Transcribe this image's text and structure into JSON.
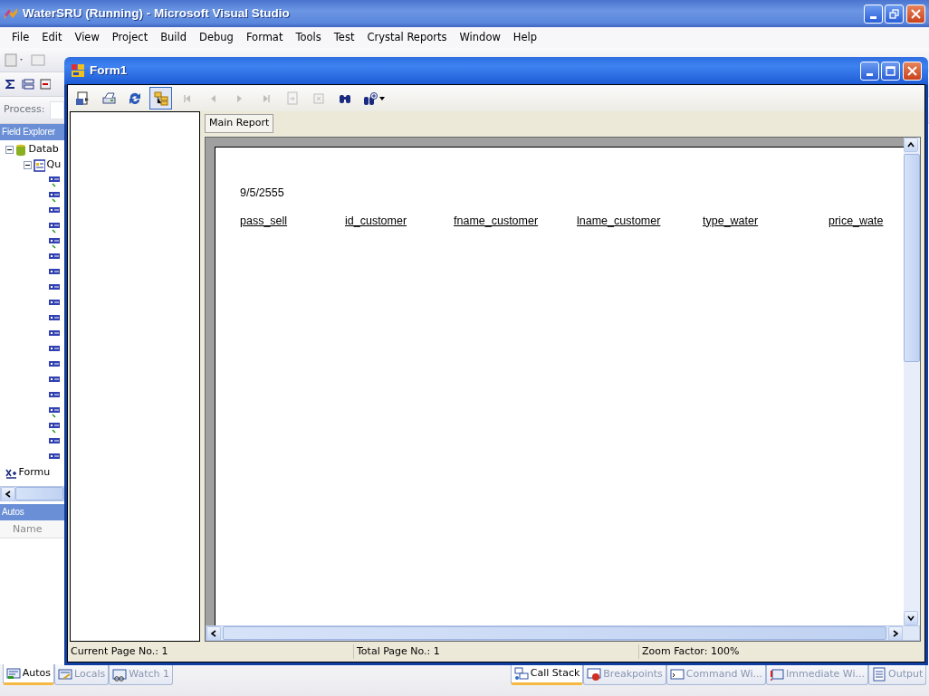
{
  "window": {
    "title": "WaterSRU (Running) - Microsoft Visual Studio"
  },
  "menu": [
    "File",
    "Edit",
    "View",
    "Project",
    "Build",
    "Debug",
    "Format",
    "Tools",
    "Test",
    "Crystal Reports",
    "Window",
    "Help"
  ],
  "toolbar": {
    "process_label": "Process:"
  },
  "field_explorer": {
    "title": "Field Explorer",
    "tree": [
      {
        "kind": "database",
        "label": "Datab",
        "expanded": true,
        "children": [
          {
            "kind": "table",
            "label": "Qu",
            "expanded": true,
            "children": [
              {
                "kind": "field",
                "used": true
              },
              {
                "kind": "field",
                "used": true
              },
              {
                "kind": "field",
                "used": false
              },
              {
                "kind": "field",
                "used": true
              },
              {
                "kind": "field",
                "used": true
              },
              {
                "kind": "field",
                "used": false
              },
              {
                "kind": "field",
                "used": false
              },
              {
                "kind": "field",
                "used": false
              },
              {
                "kind": "field",
                "used": false
              },
              {
                "kind": "field",
                "used": false
              },
              {
                "kind": "field",
                "used": false
              },
              {
                "kind": "field",
                "used": false
              },
              {
                "kind": "field",
                "used": false
              },
              {
                "kind": "field",
                "used": false
              },
              {
                "kind": "field",
                "used": false
              },
              {
                "kind": "field",
                "used": true
              },
              {
                "kind": "field",
                "used": true
              },
              {
                "kind": "field",
                "used": false
              },
              {
                "kind": "field",
                "used": false
              }
            ]
          }
        ]
      },
      {
        "kind": "formula",
        "label": "Formu"
      }
    ]
  },
  "autos": {
    "title": "Autos",
    "columns": [
      "Name"
    ]
  },
  "bottom_tabs_left": [
    {
      "label": "Autos",
      "kind": "autos",
      "selected": true
    },
    {
      "label": "Locals",
      "kind": "locals",
      "selected": false
    },
    {
      "label": "Watch 1",
      "kind": "watch",
      "selected": false
    }
  ],
  "bottom_tabs_right": [
    {
      "label": "Call Stack",
      "kind": "callstack",
      "selected": true
    },
    {
      "label": "Breakpoints",
      "kind": "breakpoints",
      "selected": false
    },
    {
      "label": "Command Wi...",
      "kind": "command",
      "selected": false
    },
    {
      "label": "Immediate Wi...",
      "kind": "immediate",
      "selected": false
    },
    {
      "label": "Output",
      "kind": "output",
      "selected": false
    }
  ],
  "form": {
    "title": "Form1",
    "toolbar": [
      {
        "kind": "export",
        "disabled": false,
        "selected": false
      },
      {
        "kind": "print",
        "disabled": false,
        "selected": false
      },
      {
        "kind": "refresh",
        "disabled": false,
        "selected": false
      },
      {
        "kind": "tree",
        "disabled": false,
        "selected": true
      },
      {
        "kind": "first",
        "disabled": true,
        "selected": false
      },
      {
        "kind": "prev",
        "disabled": true,
        "selected": false
      },
      {
        "kind": "next",
        "disabled": true,
        "selected": false
      },
      {
        "kind": "last",
        "disabled": true,
        "selected": false
      },
      {
        "kind": "goto",
        "disabled": true,
        "selected": false
      },
      {
        "kind": "stop",
        "disabled": true,
        "selected": false
      },
      {
        "kind": "find",
        "disabled": false,
        "selected": false
      },
      {
        "kind": "zoom",
        "disabled": false,
        "selected": false
      }
    ],
    "tabs": [
      {
        "label": "Main Report",
        "selected": true
      }
    ],
    "report": {
      "date": "9/5/2555",
      "columns": [
        "pass_sell",
        "id_customer",
        "fname_customer",
        "lname_customer",
        "type_water",
        "price_wate"
      ]
    },
    "status": [
      "Current Page No.: 1",
      "Total Page No.: 1",
      "Zoom Factor: 100%"
    ]
  }
}
